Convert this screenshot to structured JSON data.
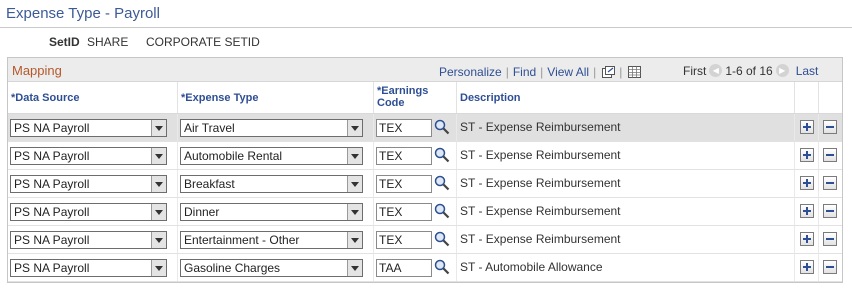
{
  "page": {
    "title": "Expense Type - Payroll",
    "setid_label": "SetID",
    "setid_value": "SHARE",
    "setid_description": "CORPORATE SETID"
  },
  "grid": {
    "title": "Mapping",
    "nav": {
      "personalize": "Personalize",
      "find": "Find",
      "view_all": "View All",
      "first": "First",
      "range": "1-6 of 16",
      "last": "Last",
      "icons": [
        "new-window-icon",
        "spreadsheet-icon",
        "previous-arrow-icon",
        "next-arrow-icon"
      ]
    },
    "headers": {
      "data_source": "*Data Source",
      "expense_type": "*Expense Type",
      "earnings_code_line1": "*Earnings",
      "earnings_code_line2": "Code",
      "description": "Description"
    },
    "rows": [
      {
        "data_source": "PS NA Payroll",
        "expense_type": "Air Travel",
        "earnings_code": "TEX",
        "description": "ST - Expense Reimbursement"
      },
      {
        "data_source": "PS NA Payroll",
        "expense_type": "Automobile Rental",
        "earnings_code": "TEX",
        "description": "ST - Expense Reimbursement"
      },
      {
        "data_source": "PS NA Payroll",
        "expense_type": "Breakfast",
        "earnings_code": "TEX",
        "description": "ST - Expense Reimbursement"
      },
      {
        "data_source": "PS NA Payroll",
        "expense_type": "Dinner",
        "earnings_code": "TEX",
        "description": "ST - Expense Reimbursement"
      },
      {
        "data_source": "PS NA Payroll",
        "expense_type": "Entertainment - Other",
        "earnings_code": "TEX",
        "description": "ST - Expense Reimbursement"
      },
      {
        "data_source": "PS NA Payroll",
        "expense_type": "Gasoline Charges",
        "earnings_code": "TAA",
        "description": "ST - Automobile Allowance"
      }
    ]
  },
  "colors": {
    "title": "#3c5a96",
    "link": "#2e4f94",
    "grid_title": "#b4582a",
    "active_row": "#e0e0e0"
  }
}
